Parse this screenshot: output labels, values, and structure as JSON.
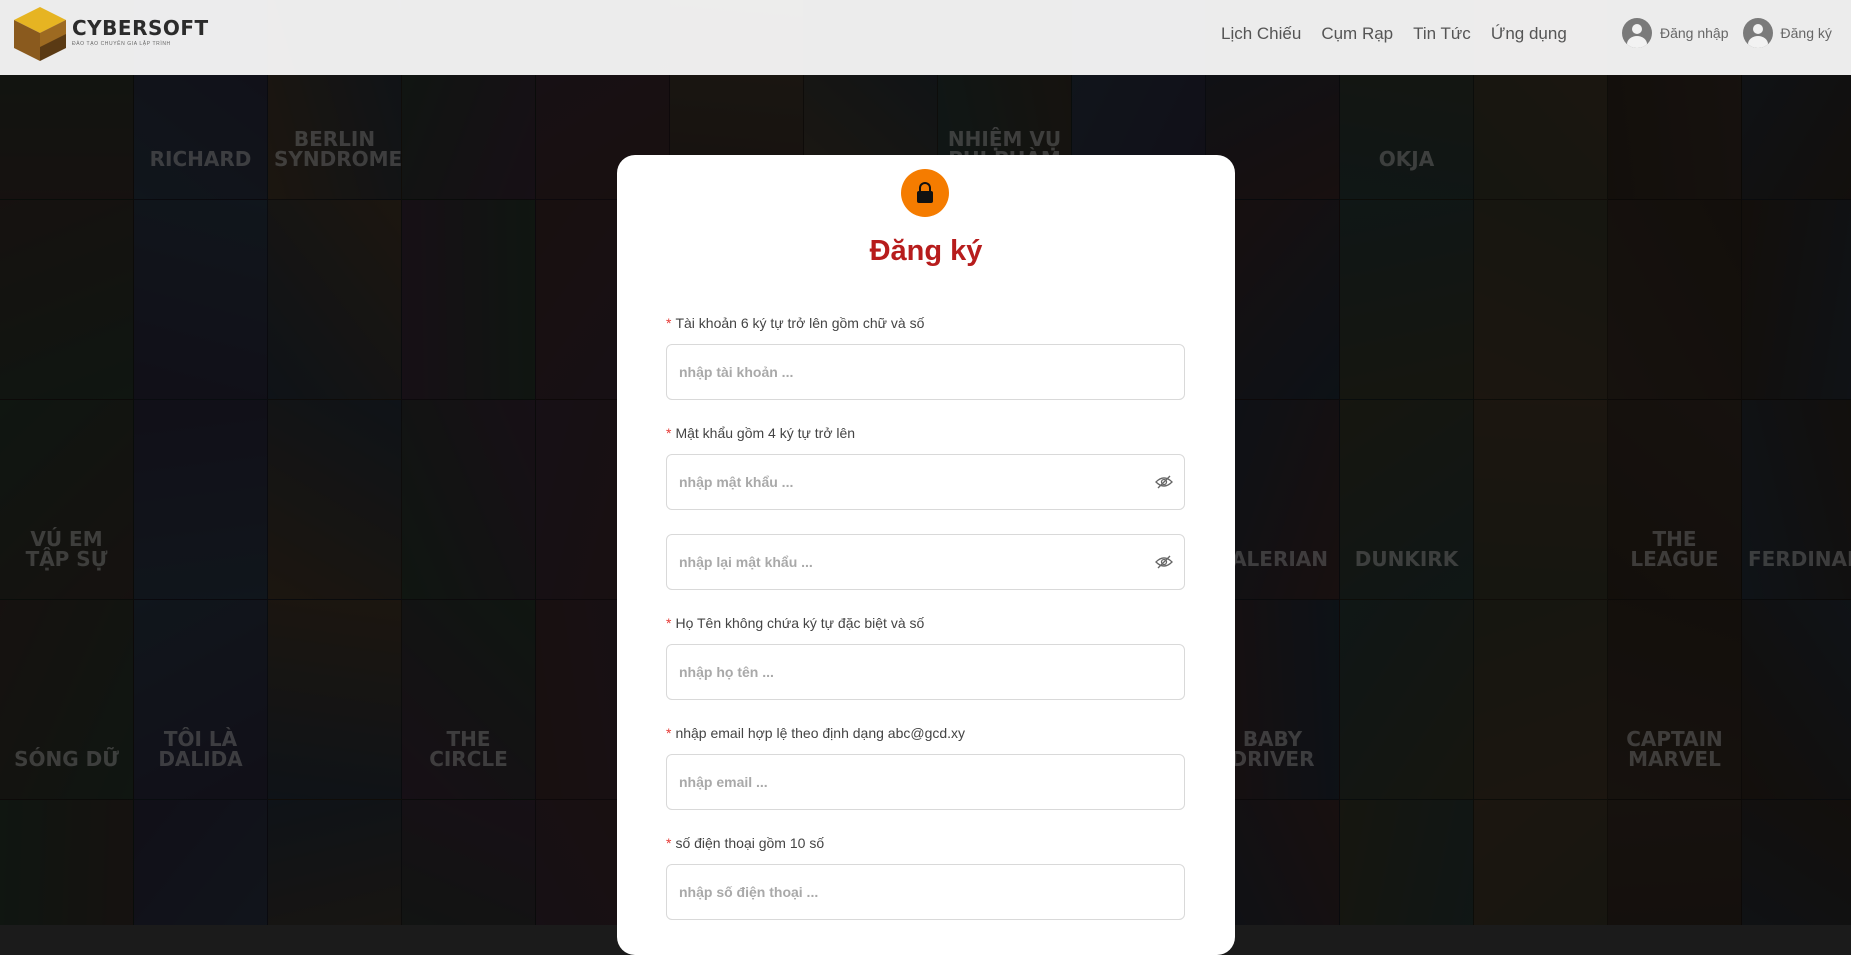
{
  "header": {
    "logo_title": "CYBERSOFT",
    "logo_subtitle": "ĐÀO TẠO CHUYÊN GIA LẬP TRÌNH",
    "nav": [
      "Lịch Chiếu",
      "Cụm Rạp",
      "Tin Tức",
      "Ứng dụng"
    ],
    "login_label": "Đăng nhập",
    "register_label": "Đăng ký"
  },
  "form": {
    "title": "Đăng ký",
    "username": {
      "label": "Tài khoản 6 ký tự trở lên gồm chữ và số",
      "placeholder": "nhập tài khoản ..."
    },
    "password": {
      "label": "Mật khẩu gồm 4 ký tự trở lên",
      "placeholder": "nhập mật khẩu ..."
    },
    "confirm_password": {
      "placeholder": "nhập lại mật khẩu ..."
    },
    "fullname": {
      "label": "Họ Tên không chứa ký tự đặc biệt và số",
      "placeholder": "nhập họ tên ..."
    },
    "email": {
      "label": "nhập email hợp lệ theo định dạng abc@gcd.xy",
      "placeholder": "nhập email ..."
    },
    "phone": {
      "label": "số điện thoại gồm 10 số",
      "placeholder": "nhập số điện thoại ..."
    }
  },
  "background_posters": [
    "",
    "RICHARD",
    "BERLIN SYNDROME",
    "",
    "",
    "",
    "",
    "NHIỆM VỤ PHI PHÀM",
    "",
    "",
    "okja",
    "",
    "",
    "",
    "",
    "",
    "",
    "",
    "",
    "",
    "",
    "",
    "",
    "",
    "",
    "",
    "",
    "",
    "VÚ EM TẬP SỰ",
    "",
    "",
    "",
    "",
    "",
    "",
    "",
    "",
    "VALERIAN",
    "DUNKIRK",
    "",
    "THE LEAGUE",
    "FERDINAND",
    "SÓNG DỮ",
    "TÔI LÀ DALIDA",
    "",
    "THE CIRCLE",
    "",
    "",
    "",
    "",
    "",
    "BABY DRIVER",
    "",
    "",
    "CAPTAIN MARVEL",
    "",
    "",
    "",
    "",
    "",
    "",
    "",
    "",
    "",
    "",
    "",
    "",
    "",
    "",
    ""
  ],
  "colors": {
    "accent_orange": "#f57c00",
    "title_red": "#b71c1c",
    "required_star": "#e53935"
  }
}
